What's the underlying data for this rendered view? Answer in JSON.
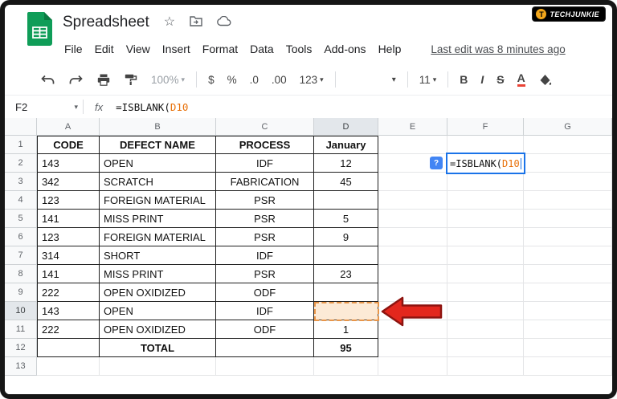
{
  "watermark": {
    "text": "TECHJUNKIE",
    "logo_letter": "T"
  },
  "header": {
    "title": "Spreadsheet",
    "menu_items": [
      "File",
      "Edit",
      "View",
      "Insert",
      "Format",
      "Data",
      "Tools",
      "Add-ons",
      "Help"
    ],
    "last_edit": "Last edit was 8 minutes ago"
  },
  "toolbar": {
    "zoom": "100%",
    "currency": "$",
    "percent": "%",
    "decrease_decimal": ".0",
    "increase_decimal": ".00",
    "more_formats": "123",
    "font_size": "11",
    "bold": "B",
    "italic": "I",
    "strikethrough": "S",
    "text_color": "A"
  },
  "formula_bar": {
    "name_box": "F2",
    "fx_label": "fx",
    "formula_prefix": "=ISBLANK(",
    "formula_ref": "D10"
  },
  "edit_overlay": {
    "cell": "F2",
    "help_badge": "?",
    "formula_prefix": "=ISBLANK(",
    "formula_ref": "D10"
  },
  "colors": {
    "accent_blue": "#1a73e8",
    "ref_orange": "#e8710a",
    "ref_fill": "#fbe8d4",
    "arrow_red": "#e3271d",
    "sheets_green": "#0f9d58"
  },
  "grid": {
    "column_headers": [
      "A",
      "B",
      "C",
      "D",
      "E",
      "F",
      "G"
    ],
    "row_numbers": [
      1,
      2,
      3,
      4,
      5,
      6,
      7,
      8,
      9,
      10,
      11,
      12,
      13
    ],
    "highlighted_column": "D",
    "highlighted_row": 10,
    "formatting": {
      "header_row": 0,
      "total_row": 11,
      "boxed_last_row": 11,
      "boxed_last_col": 3
    },
    "column_alignment": [
      "left",
      "left",
      "center",
      "center",
      "center",
      "center",
      "center"
    ],
    "rows": [
      [
        "CODE",
        "DEFECT NAME",
        "PROCESS",
        "January",
        "",
        "",
        ""
      ],
      [
        "143",
        "OPEN",
        "IDF",
        "12",
        "",
        "",
        ""
      ],
      [
        "342",
        "SCRATCH",
        "FABRICATION",
        "45",
        "",
        "",
        ""
      ],
      [
        "123",
        "FOREIGN MATERIAL",
        "PSR",
        "",
        "",
        "",
        ""
      ],
      [
        "141",
        "MISS PRINT",
        "PSR",
        "5",
        "",
        "",
        ""
      ],
      [
        "123",
        "FOREIGN MATERIAL",
        "PSR",
        "9",
        "",
        "",
        ""
      ],
      [
        "314",
        "SHORT",
        "IDF",
        "",
        "",
        "",
        ""
      ],
      [
        "141",
        "MISS PRINT",
        "PSR",
        "23",
        "",
        "",
        ""
      ],
      [
        "222",
        "OPEN OXIDIZED",
        "ODF",
        "",
        "",
        "",
        ""
      ],
      [
        "143",
        "OPEN",
        "IDF",
        "",
        "",
        "",
        ""
      ],
      [
        "222",
        "OPEN OXIDIZED",
        "ODF",
        "1",
        "",
        "",
        ""
      ],
      [
        "",
        "TOTAL",
        "",
        "95",
        "",
        "",
        ""
      ],
      [
        "",
        "",
        "",
        "",
        "",
        "",
        ""
      ]
    ]
  }
}
